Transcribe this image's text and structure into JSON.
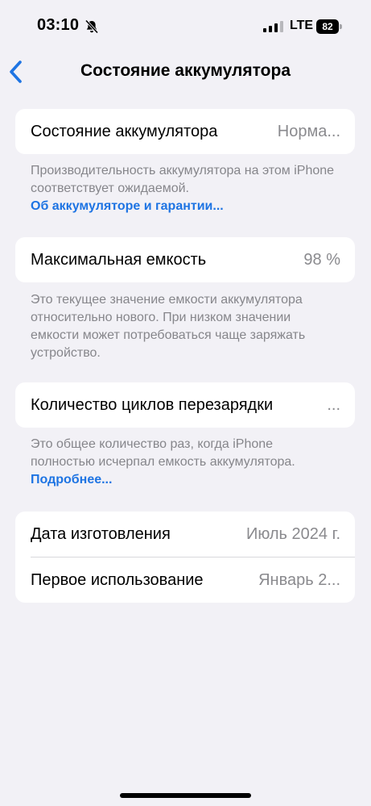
{
  "status_bar": {
    "time": "03:10",
    "network": "LTE",
    "battery_level": "82",
    "icons": [
      "bell-slash-icon",
      "signal-icon",
      "battery-icon"
    ]
  },
  "nav": {
    "title": "Состояние аккумулятора",
    "back_icon": "chevron-left-icon"
  },
  "battery_health": {
    "label": "Состояние аккумулятора",
    "value": "Норма..."
  },
  "health_footnote": {
    "text": "Производительность аккумулятора на этом iPhone соответствует ожидаемой.",
    "link": "Об аккумуляторе и гарантии..."
  },
  "max_capacity": {
    "label": "Максимальная емкость",
    "value": "98 %"
  },
  "capacity_footnote": {
    "text": "Это текущее значение емкости аккумулятора относительно нового. При низком значении емкости может потребоваться чаще заряжать устройство."
  },
  "cycle_count": {
    "label": "Количество циклов перезарядки",
    "value": "..."
  },
  "cycle_footnote": {
    "text": "Это общее количество раз, когда iPhone полностью исчерпал емкость аккумулятора.",
    "link": "Подробнее..."
  },
  "dates": {
    "manufacture_label": "Дата изготовления",
    "manufacture_value": "Июль 2024 г.",
    "first_use_label": "Первое использование",
    "first_use_value": "Январь 2..."
  },
  "colors": {
    "accent": "#1e74e3",
    "background": "#f2f1f6",
    "secondary_text": "#8a8a8e"
  }
}
